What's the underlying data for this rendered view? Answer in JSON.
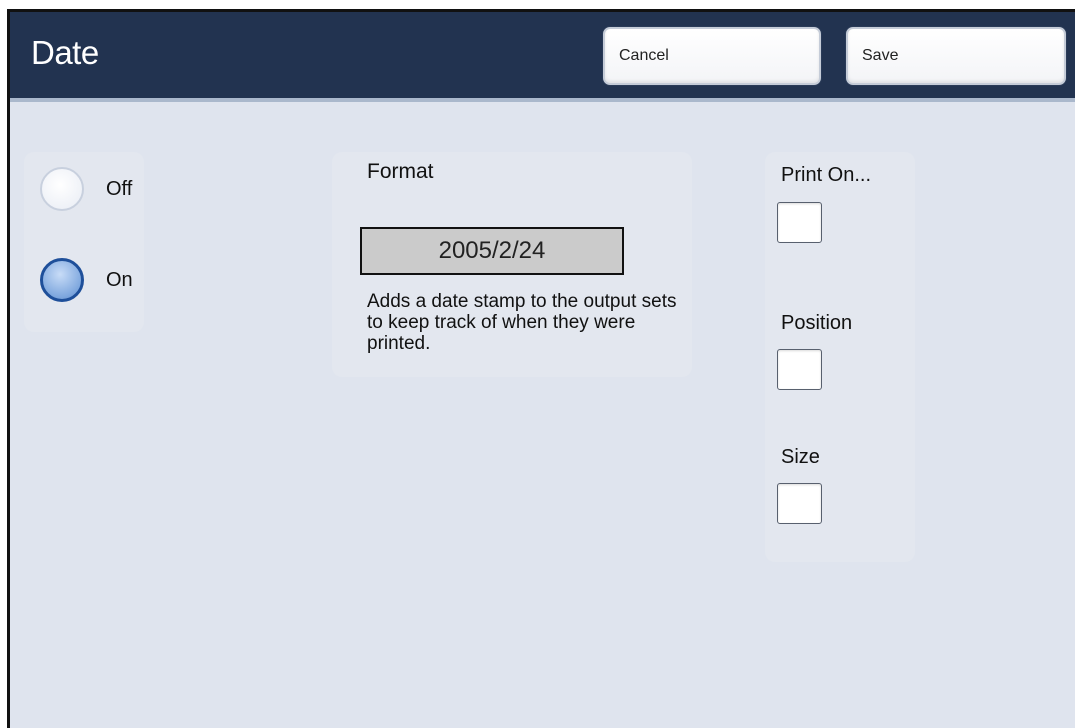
{
  "header": {
    "title": "Date",
    "cancel_label": "Cancel",
    "save_label": "Save"
  },
  "mode": {
    "options": [
      {
        "label": "Off",
        "selected": false
      },
      {
        "label": "On",
        "selected": true
      }
    ]
  },
  "format": {
    "label": "Format",
    "value": "2005/2/24",
    "description": "Adds a date stamp to the output sets to keep track of when they were printed."
  },
  "options": {
    "print_on_label": "Print On...",
    "position_label": "Position",
    "size_label": "Size"
  }
}
